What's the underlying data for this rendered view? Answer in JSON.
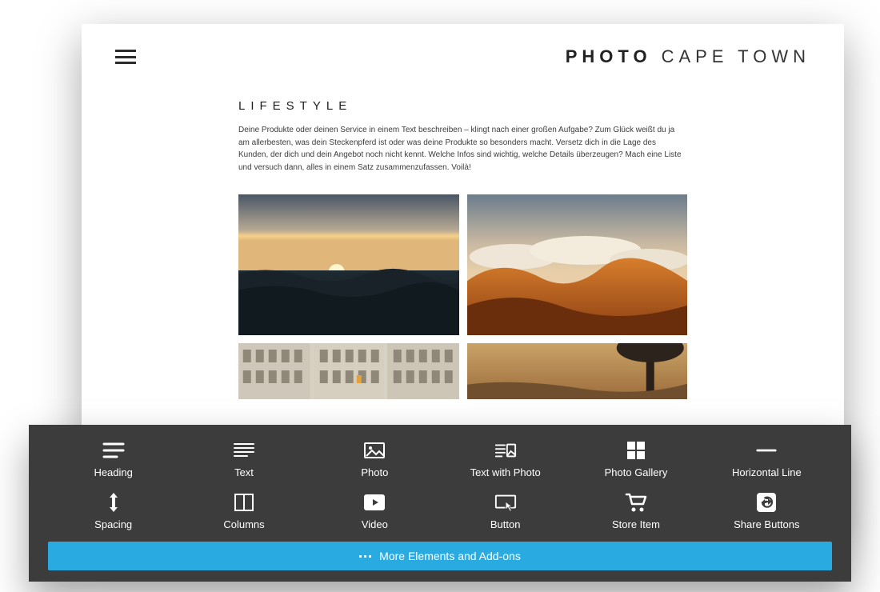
{
  "site": {
    "title_bold": "PHOTO",
    "title_thin": "CAPE TOWN"
  },
  "section": {
    "heading": "LIFESTYLE",
    "description": "Deine Produkte oder deinen Service in einem Text beschreiben – klingt nach einer großen Aufgabe? Zum Glück weißt du ja am allerbesten, was dein Steckenpferd ist oder was deine Produkte so besonders macht. Versetz dich in die Lage des Kunden, der dich und dein Angebot noch nicht kennt. Welche Infos sind wichtig, welche Details überzeugen? Mach eine Liste und versuch dann, alles in einem Satz zusammenzufassen. Voilà!"
  },
  "toolbar": {
    "row1": [
      {
        "name": "heading",
        "label": "Heading"
      },
      {
        "name": "text",
        "label": "Text"
      },
      {
        "name": "photo",
        "label": "Photo"
      },
      {
        "name": "text-with-photo",
        "label": "Text with Photo"
      },
      {
        "name": "photo-gallery",
        "label": "Photo Gallery"
      },
      {
        "name": "horizontal-line",
        "label": "Horizontal Line"
      }
    ],
    "row2": [
      {
        "name": "spacing",
        "label": "Spacing"
      },
      {
        "name": "columns",
        "label": "Columns"
      },
      {
        "name": "video",
        "label": "Video"
      },
      {
        "name": "button",
        "label": "Button"
      },
      {
        "name": "store-item",
        "label": "Store Item"
      },
      {
        "name": "share-buttons",
        "label": "Share Buttons"
      }
    ],
    "more_label": "More Elements and Add-ons"
  }
}
